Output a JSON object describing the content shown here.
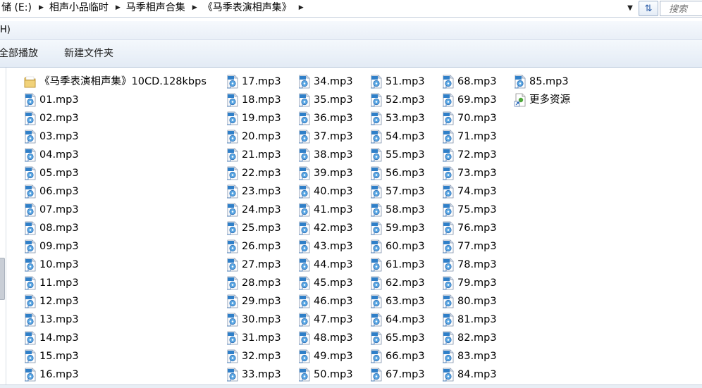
{
  "address_bar": {
    "crumbs": [
      "储 (E:)",
      "相声小品临时",
      "马季相声合集",
      "《马季表演相声集》"
    ],
    "search_placeholder": "搜索"
  },
  "menu": {
    "help_label": "H)"
  },
  "toolbar": {
    "play_all_label": "全部播放",
    "new_folder_label": "新建文件夹"
  },
  "icons": {
    "breadcrumb_separator": "triangle-right-icon",
    "dropdown": "chevron-down-icon",
    "refresh": "refresh-icon",
    "folder": "folder-icon",
    "mp3": "mp3-file-icon",
    "shortcut": "shortcut-file-icon"
  },
  "colors": {
    "folder_yellow": "#e8c25a",
    "mp3_blue": "#2f7fc8",
    "toolbar_bg": "#e9eff7"
  },
  "files": [
    [
      "《马季表演相声集》10CD.128kbps",
      "01.mp3",
      "02.mp3",
      "03.mp3",
      "04.mp3",
      "05.mp3",
      "06.mp3",
      "07.mp3",
      "08.mp3",
      "09.mp3",
      "10.mp3",
      "11.mp3",
      "12.mp3",
      "13.mp3",
      "14.mp3",
      "15.mp3",
      "16.mp3"
    ],
    [
      "17.mp3",
      "18.mp3",
      "19.mp3",
      "20.mp3",
      "21.mp3",
      "22.mp3",
      "23.mp3",
      "24.mp3",
      "25.mp3",
      "26.mp3",
      "27.mp3",
      "28.mp3",
      "29.mp3",
      "30.mp3",
      "31.mp3",
      "32.mp3",
      "33.mp3"
    ],
    [
      "34.mp3",
      "35.mp3",
      "36.mp3",
      "37.mp3",
      "38.mp3",
      "39.mp3",
      "40.mp3",
      "41.mp3",
      "42.mp3",
      "43.mp3",
      "44.mp3",
      "45.mp3",
      "46.mp3",
      "47.mp3",
      "48.mp3",
      "49.mp3",
      "50.mp3"
    ],
    [
      "51.mp3",
      "52.mp3",
      "53.mp3",
      "54.mp3",
      "55.mp3",
      "56.mp3",
      "57.mp3",
      "58.mp3",
      "59.mp3",
      "60.mp3",
      "61.mp3",
      "62.mp3",
      "63.mp3",
      "64.mp3",
      "65.mp3",
      "66.mp3",
      "67.mp3"
    ],
    [
      "68.mp3",
      "69.mp3",
      "70.mp3",
      "71.mp3",
      "72.mp3",
      "73.mp3",
      "74.mp3",
      "75.mp3",
      "76.mp3",
      "77.mp3",
      "78.mp3",
      "79.mp3",
      "80.mp3",
      "81.mp3",
      "82.mp3",
      "83.mp3",
      "84.mp3"
    ],
    [
      "85.mp3",
      "更多资源"
    ]
  ]
}
